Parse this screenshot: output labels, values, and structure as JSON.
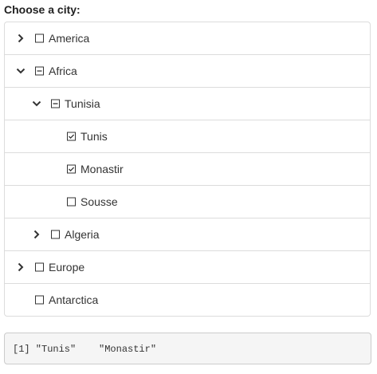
{
  "title": "Choose a city:",
  "tree": {
    "items": [
      {
        "label": "America",
        "level": 0,
        "expander": "collapsed",
        "check": "unchecked"
      },
      {
        "label": "Africa",
        "level": 0,
        "expander": "expanded",
        "check": "indeterminate"
      },
      {
        "label": "Tunisia",
        "level": 1,
        "expander": "expanded",
        "check": "indeterminate"
      },
      {
        "label": "Tunis",
        "level": 2,
        "expander": "none",
        "check": "checked"
      },
      {
        "label": "Monastir",
        "level": 2,
        "expander": "none",
        "check": "checked"
      },
      {
        "label": "Sousse",
        "level": 2,
        "expander": "none",
        "check": "unchecked"
      },
      {
        "label": "Algeria",
        "level": 1,
        "expander": "collapsed",
        "check": "unchecked"
      },
      {
        "label": "Europe",
        "level": 0,
        "expander": "collapsed",
        "check": "unchecked"
      },
      {
        "label": "Antarctica",
        "level": 0,
        "expander": "none",
        "check": "unchecked"
      }
    ]
  },
  "output": {
    "text": "[1] \"Tunis\"    \"Monastir\""
  }
}
